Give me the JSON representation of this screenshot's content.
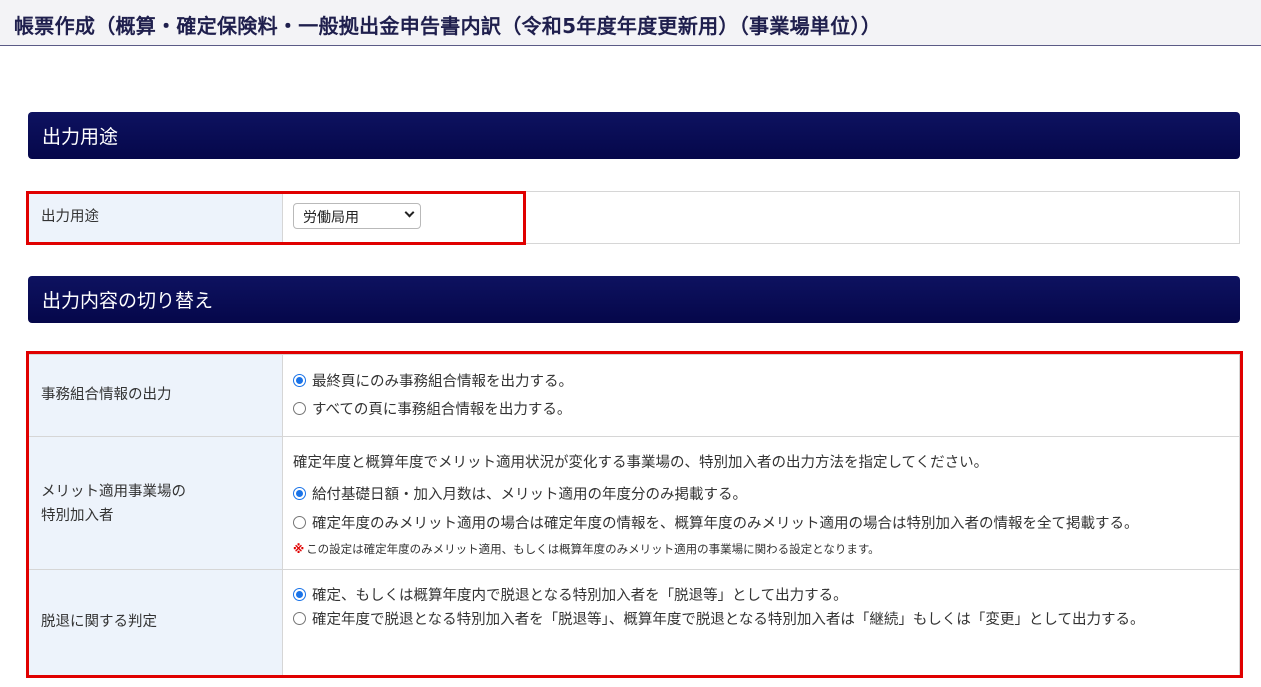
{
  "page": {
    "title": "帳票作成（概算・確定保険料・一般拠出金申告書内訳（令和5年度年度更新用）（事業場単位））"
  },
  "section1": {
    "heading": "出力用途",
    "row": {
      "label": "出力用途",
      "select_value": "労働局用"
    }
  },
  "section2": {
    "heading": "出力内容の切り替え",
    "rows": [
      {
        "label": "事務組合情報の出力",
        "options": [
          {
            "text": "最終頁にのみ事務組合情報を出力する。",
            "selected": true
          },
          {
            "text": "すべての頁に事務組合情報を出力する。",
            "selected": false
          }
        ]
      },
      {
        "label_line1": "メリット適用事業場の",
        "label_line2": "特別加入者",
        "description": "確定年度と概算年度でメリット適用状況が変化する事業場の、特別加入者の出力方法を指定してください。",
        "options": [
          {
            "text": "給付基礎日額・加入月数は、メリット適用の年度分のみ掲載する。",
            "selected": true
          },
          {
            "text": "確定年度のみメリット適用の場合は確定年度の情報を、概算年度のみメリット適用の場合は特別加入者の情報を全て掲載する。",
            "selected": false
          }
        ],
        "note_mark": "※",
        "note": "この設定は確定年度のみメリット適用、もしくは概算年度のみメリット適用の事業場に関わる設定となります。"
      },
      {
        "label": "脱退に関する判定",
        "options": [
          {
            "text": "確定、もしくは概算年度内で脱退となる特別加入者を「脱退等」として出力する。",
            "selected": true
          },
          {
            "text": "確定年度で脱退となる特別加入者を「脱退等」、概算年度で脱退となる特別加入者は「継続」もしくは「変更」として出力する。",
            "selected": false
          }
        ]
      }
    ]
  },
  "colors": {
    "section_bar": "#0b0f5a",
    "label_bg": "#edf3fb",
    "highlight": "#e00000",
    "radio_accent": "#1a73e8"
  }
}
